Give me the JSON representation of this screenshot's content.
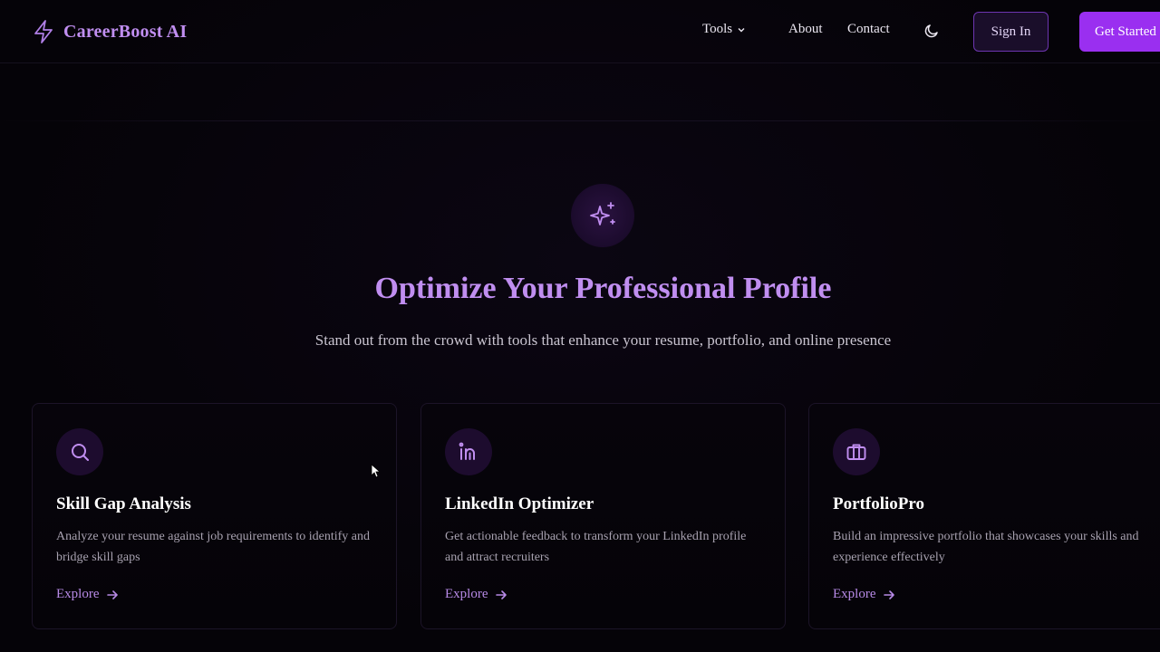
{
  "header": {
    "logo_text": "CareerBoost AI",
    "logo_icon": "lightning-bolt-icon",
    "nav": {
      "tools_label": "Tools",
      "about_label": "About",
      "contact_label": "Contact"
    },
    "theme_toggle_icon": "moon-icon",
    "sign_in_label": "Sign In",
    "get_started_label": "Get Started"
  },
  "hero": {
    "icon": "sparkles-icon",
    "title": "Optimize Your Professional Profile",
    "subtitle": "Stand out from the crowd with tools that enhance your resume, portfolio, and online presence"
  },
  "cards": [
    {
      "icon": "search-icon",
      "title": "Skill Gap Analysis",
      "description": "Analyze your resume against job requirements to identify and bridge skill gaps",
      "link_label": "Explore"
    },
    {
      "icon": "linkedin-icon",
      "title": "LinkedIn Optimizer",
      "description": "Get actionable feedback to transform your LinkedIn profile and attract recruiters",
      "link_label": "Explore"
    },
    {
      "icon": "briefcase-icon",
      "title": "PortfolioPro",
      "description": "Build an impressive portfolio that showcases your skills and experience effectively",
      "link_label": "Explore"
    }
  ],
  "colors": {
    "accent": "#c08ef0",
    "button_primary": "#9a2ff0",
    "background": "#050308"
  }
}
